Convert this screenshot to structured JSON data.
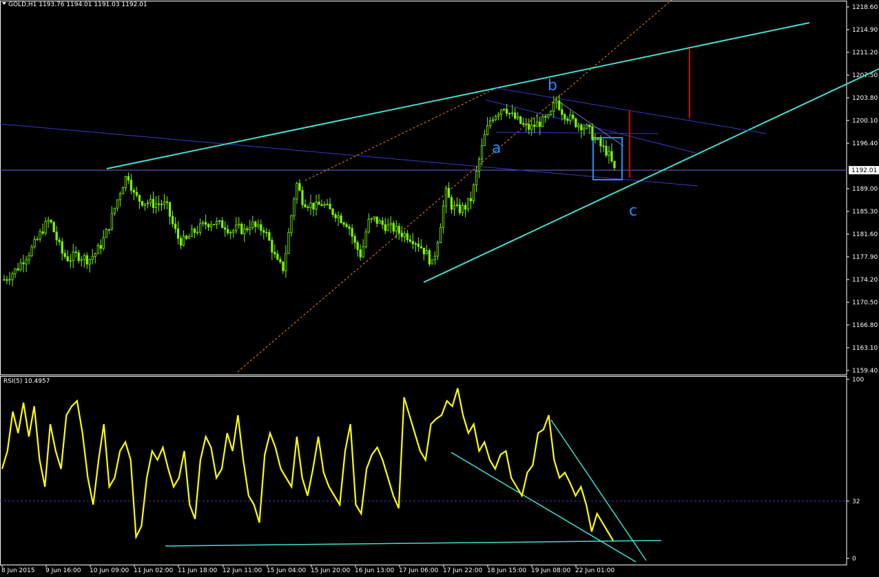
{
  "colors": {
    "background": "#000000",
    "axis": "#ffffff",
    "candle_up": "#7CFC00",
    "candle_down": "#7CFC00",
    "trendline": "#40E0D0",
    "channel_line": "#3838C8",
    "fib_line": "#FF8C00",
    "rsi_line": "#FFFF00",
    "rsi_level": "#4040B0",
    "target_marker": "#E00000",
    "box": "#1E90FF",
    "wave_label": "#1E90FF",
    "current_price_bg": "#ffffff",
    "current_price_text": "#000000"
  },
  "price_panel": {
    "header": "GOLD,H1  1193.76 1194.01 1191.03 1192.01",
    "y_ticks": [
      "1218.60",
      "1214.90",
      "1211.20",
      "1207.50",
      "1203.80",
      "1200.10",
      "1196.40",
      "1189.00",
      "1185.30",
      "1181.60",
      "1177.90",
      "1174.20",
      "1170.50",
      "1166.80",
      "1163.10",
      "1159.40"
    ],
    "current_price": "1192.01",
    "wave_labels": {
      "a": "a",
      "b": "b",
      "c": "c"
    }
  },
  "rsi_panel": {
    "header": "RSI(5) 10.4957",
    "y_ticks": [
      "100",
      "32",
      "0"
    ],
    "level": 32
  },
  "x_ticks": [
    "8 Jun 2015",
    "9 Jun 16:00",
    "10 Jun 09:00",
    "11 Jun 02:00",
    "11 Jun 18:00",
    "12 Jun 11:00",
    "15 Jun 04:00",
    "15 Jun 20:00",
    "16 Jun 13:00",
    "17 Jun 06:00",
    "17 Jun 22:00",
    "18 Jun 15:00",
    "19 Jun 08:00",
    "22 Jun 01:00"
  ],
  "chart_data": [
    {
      "type": "line",
      "title": "GOLD,H1",
      "xlabel": "",
      "ylabel": "",
      "ylim": [
        1159.4,
        1220.4
      ],
      "x_tick_labels": [
        "8 Jun 2015",
        "9 Jun 16:00",
        "10 Jun 09:00",
        "11 Jun 02:00",
        "11 Jun 18:00",
        "12 Jun 11:00",
        "15 Jun 04:00",
        "15 Jun 20:00",
        "16 Jun 13:00",
        "17 Jun 06:00",
        "17 Jun 22:00",
        "18 Jun 15:00",
        "19 Jun 08:00",
        "22 Jun 01:00"
      ],
      "y_tick_labels": [
        "1218.60",
        "1214.90",
        "1211.20",
        "1207.50",
        "1203.80",
        "1200.10",
        "1196.40",
        "1189.00",
        "1185.30",
        "1181.60",
        "1177.90",
        "1174.20",
        "1170.50",
        "1166.80",
        "1163.10",
        "1159.40"
      ],
      "series": [
        {
          "values": [
            1174.2,
            1175.0,
            1176.0,
            1177.5,
            1178.8,
            1180.5,
            1182.5,
            1184.0,
            1181.0,
            1178.3,
            1177.5,
            1178.2,
            1177.9,
            1177.4,
            1178.4,
            1180.0,
            1182.5,
            1185.8,
            1189.0,
            1191.5,
            1188.0,
            1187.0,
            1186.8,
            1186.5,
            1186.6,
            1186.3,
            1183.0,
            1180.5,
            1180.5,
            1181.8,
            1182.5,
            1183.3,
            1183.6,
            1183.2,
            1183.0,
            1182.0,
            1182.6,
            1182.1,
            1183.4,
            1182.4,
            1182.5,
            1180.0,
            1177.0,
            1176.0,
            1183.0,
            1190.0,
            1187.0,
            1186.5,
            1186.0,
            1186.6,
            1185.5,
            1185.0,
            1184.0,
            1183.2,
            1180.0,
            1178.0,
            1183.5,
            1184.0,
            1183.3,
            1182.8,
            1182.5,
            1181.8,
            1181.4,
            1180.8,
            1179.8,
            1178.5,
            1176.5,
            1182.0,
            1188.5,
            1186.0,
            1185.5,
            1186.0,
            1187.5,
            1193.0,
            1197.5,
            1200.5,
            1201.5,
            1202.5,
            1201.0,
            1200.2,
            1199.2,
            1198.8,
            1199.5,
            1200.0,
            1200.5,
            1203.5,
            1201.5,
            1200.5,
            1199.7,
            1199.3,
            1198.6,
            1197.0,
            1195.8,
            1194.8,
            1192.0
          ],
          "x_range_bar_index": [
            0,
            222
          ]
        }
      ],
      "annotations": [
        "a",
        "b",
        "c"
      ],
      "current_price": 1192.01,
      "grid": false,
      "legend": "none"
    },
    {
      "type": "line",
      "title": "RSI(5) 10.4957",
      "xlabel": "",
      "ylabel": "",
      "ylim": [
        0,
        100
      ],
      "y_tick_labels": [
        "100",
        "32",
        "0"
      ],
      "levels": [
        32
      ],
      "series": [
        {
          "values": [
            50,
            60,
            82,
            70,
            87,
            68,
            85,
            55,
            40,
            75,
            60,
            50,
            80,
            85,
            88,
            70,
            45,
            30,
            55,
            75,
            40,
            45,
            60,
            65,
            55,
            12,
            18,
            45,
            60,
            55,
            62,
            50,
            40,
            45,
            60,
            30,
            22,
            55,
            68,
            62,
            45,
            50,
            70,
            60,
            80,
            55,
            35,
            30,
            20,
            58,
            70,
            62,
            50,
            45,
            40,
            68,
            45,
            35,
            50,
            68,
            48,
            40,
            35,
            30,
            60,
            75,
            30,
            25,
            50,
            58,
            62,
            55,
            45,
            35,
            28,
            90,
            80,
            70,
            60,
            55,
            75,
            78,
            80,
            88,
            85,
            95,
            80,
            70,
            75,
            60,
            65,
            55,
            50,
            58,
            60,
            45,
            40,
            35,
            48,
            52,
            70,
            72,
            80,
            55,
            45,
            48,
            42,
            35,
            40,
            30,
            15,
            25,
            20,
            15,
            10
          ]
        }
      ],
      "grid": false,
      "legend": "none"
    }
  ]
}
